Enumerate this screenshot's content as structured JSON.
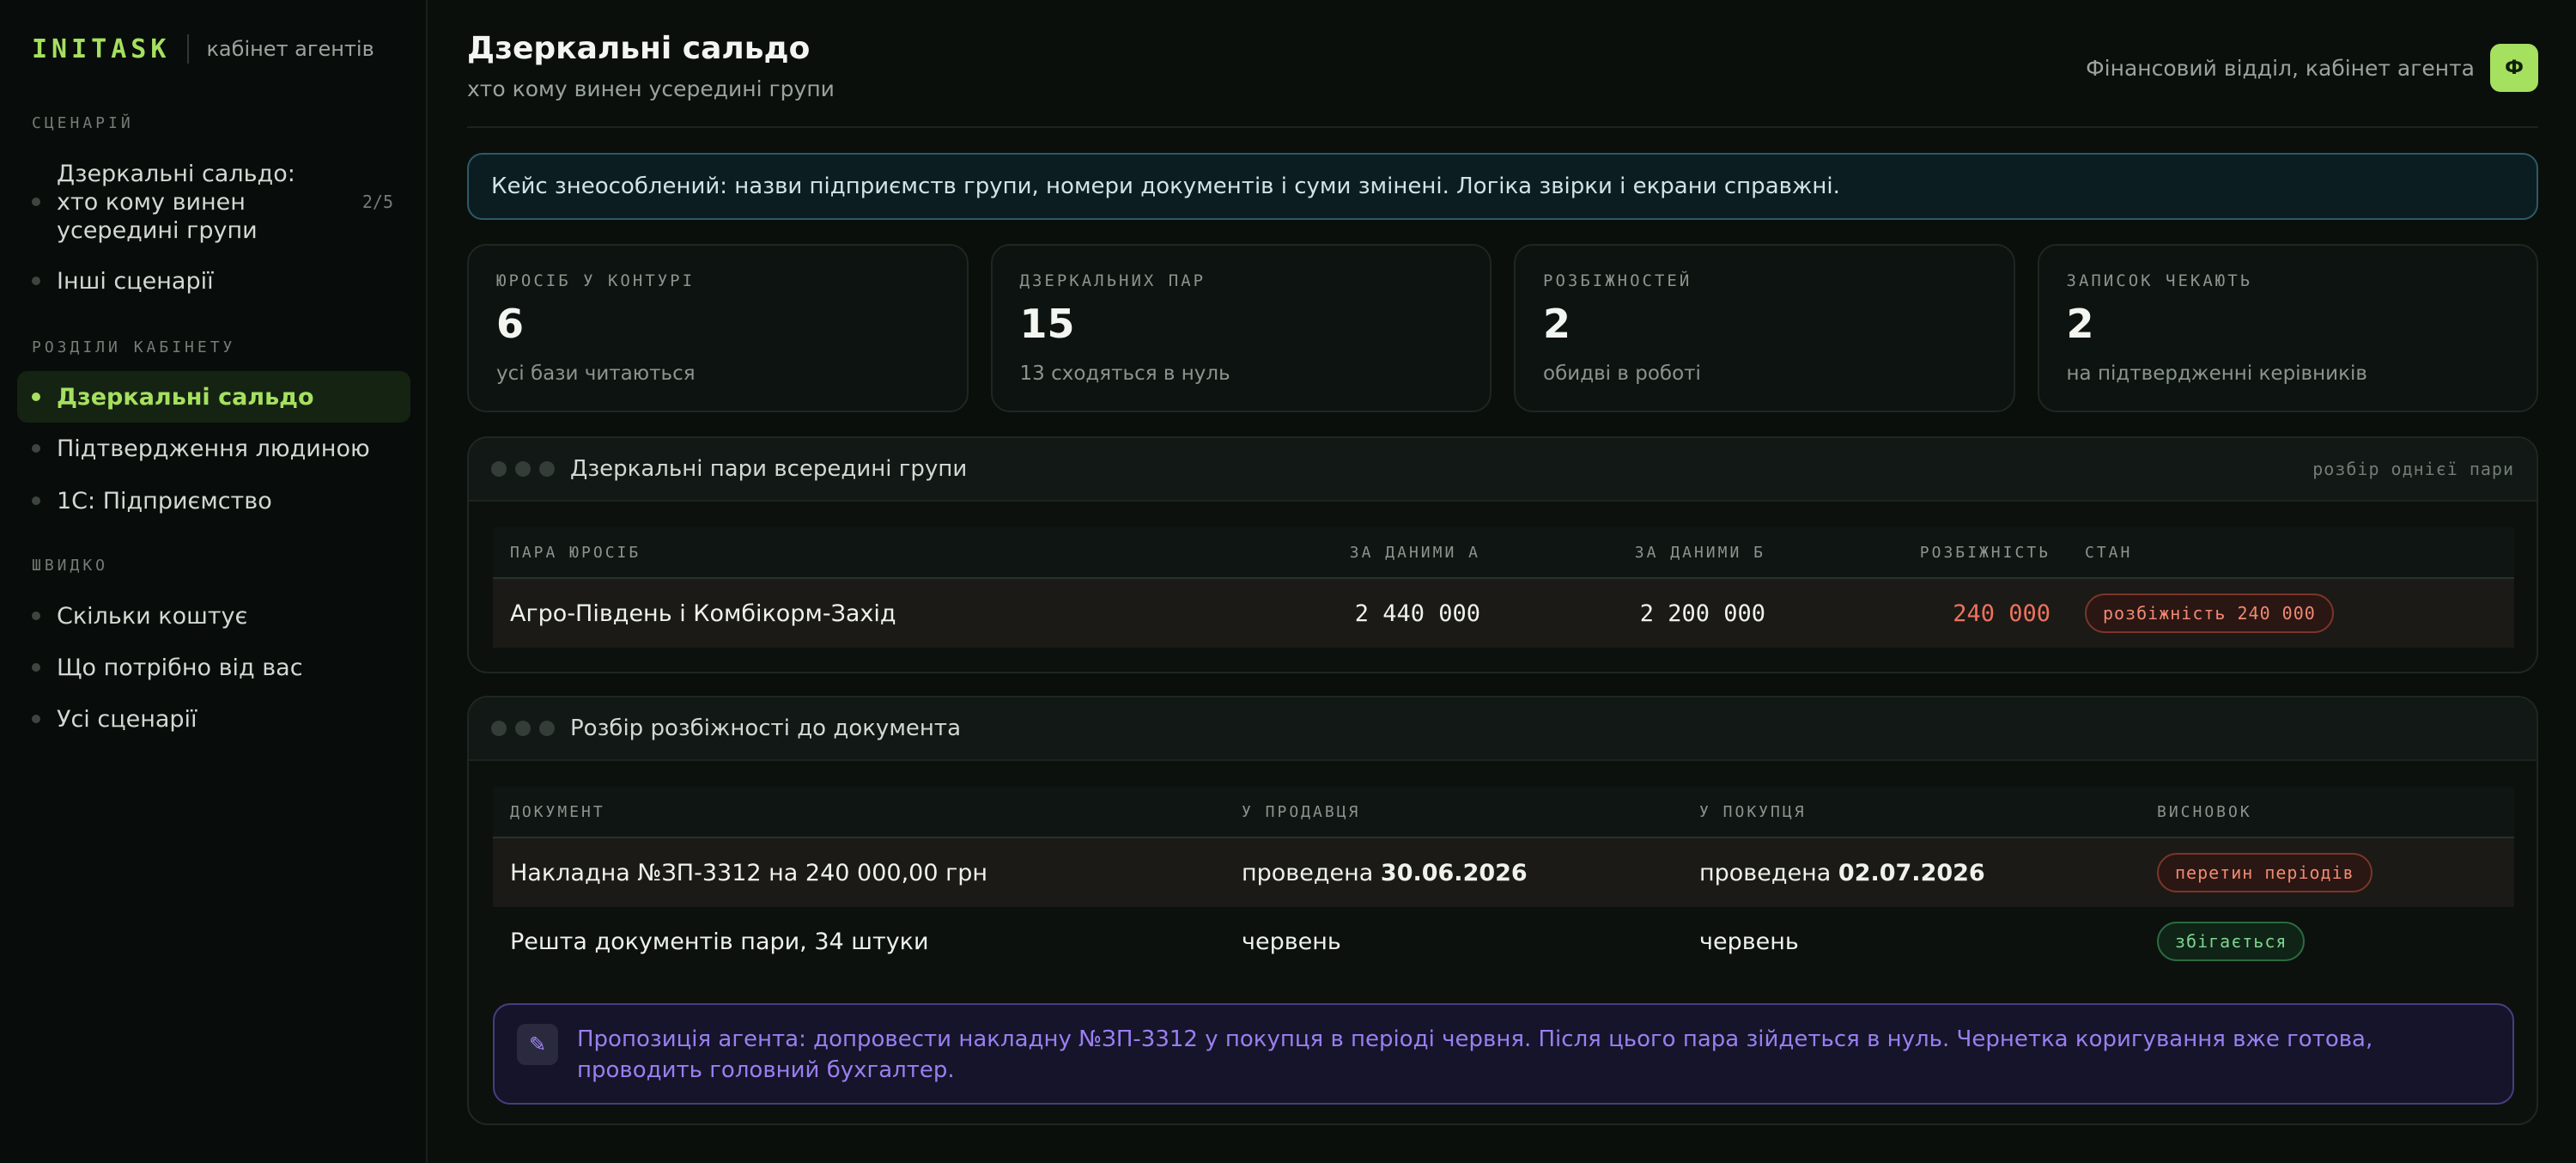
{
  "sidebar": {
    "brand": "INITASK",
    "brand_sub": "кабінет агентів",
    "sections": {
      "scenarios": "СЦЕНАРІЙ",
      "cabinet": "РОЗДІЛИ КАБІНЕТУ",
      "quick": "ШВИДКО"
    },
    "scenario_items": [
      {
        "label": "Дзеркальні сальдо: хто кому винен усередині групи",
        "badge": "2/5"
      },
      {
        "label": "Інші сценарії"
      }
    ],
    "cabinet_items": [
      {
        "label": "Дзеркальні сальдо",
        "active": true
      },
      {
        "label": "Підтвердження людиною"
      },
      {
        "label": "1С: Підприємство"
      }
    ],
    "quick_items": [
      {
        "label": "Скільки коштує"
      },
      {
        "label": "Що потрібно від вас"
      },
      {
        "label": "Усі сценарії"
      }
    ]
  },
  "header": {
    "title": "Дзеркальні сальдо",
    "subtitle": "хто кому винен усередині групи",
    "user": "Фінансовий відділ, кабінет агента",
    "avatar": "Ф"
  },
  "notice": "Кейс знеособлений: назви підприємств групи, номери документів і суми змінені. Логіка звірки і екрани справжні.",
  "stats": [
    {
      "label": "ЮРОСІБ У КОНТУРІ",
      "value": "6",
      "note": "усі бази читаються"
    },
    {
      "label": "ДЗЕРКАЛЬНИХ ПАР",
      "value": "15",
      "note": "13 сходяться в нуль"
    },
    {
      "label": "РОЗБІЖНОСТЕЙ",
      "value": "2",
      "note": "обидві в роботі"
    },
    {
      "label": "ЗАПИСОК ЧЕКАЮТЬ",
      "value": "2",
      "note": "на підтвердженні керівників"
    }
  ],
  "pairs_panel": {
    "title": "Дзеркальні пари всередині групи",
    "right_label": "розбір однієї пари",
    "headers": [
      "ПАРА ЮРОСІБ",
      "ЗА ДАНИМИ А",
      "ЗА ДАНИМИ Б",
      "РОЗБІЖНІСТЬ",
      "СТАН"
    ],
    "rows": [
      {
        "pair": "Агро-Південь і Комбікорм-Захід",
        "a": "2 440 000",
        "b": "2 200 000",
        "diff": "240 000",
        "status": "розбіжність 240 000"
      }
    ]
  },
  "docs_panel": {
    "title": "Розбір розбіжності до документа",
    "headers": [
      "ДОКУМЕНТ",
      "У ПРОДАВЦЯ",
      "У ПОКУПЦЯ",
      "ВИСНОВОК"
    ],
    "rows": [
      {
        "doc": "Накладна №ЗП-3312 на 240 000,00 грн",
        "seller_prefix": "проведена",
        "seller_date": "30.06.2026",
        "buyer_prefix": "проведена",
        "buyer_date": "02.07.2026",
        "verdict": "перетин періодів",
        "verdict_type": "red"
      },
      {
        "doc": "Решта документів пари, 34 штуки",
        "seller_prefix": "червень",
        "seller_date": "",
        "buyer_prefix": "червень",
        "buyer_date": "",
        "verdict": "збігається",
        "verdict_type": "green"
      }
    ],
    "proposal_icon": "pencil-icon",
    "proposal": "Пропозиція агента: допровести накладну №ЗП-3312 у покупця в періоді червня. Після цього пара зійдеться в нуль. Чернетка коригування вже готова, проводить головний бухгалтер."
  },
  "colors": {
    "accent": "#a5e05f",
    "danger": "#f0715e",
    "success": "#7fd58f",
    "agent": "#9a7ff0",
    "info_border": "#2c5b66"
  }
}
